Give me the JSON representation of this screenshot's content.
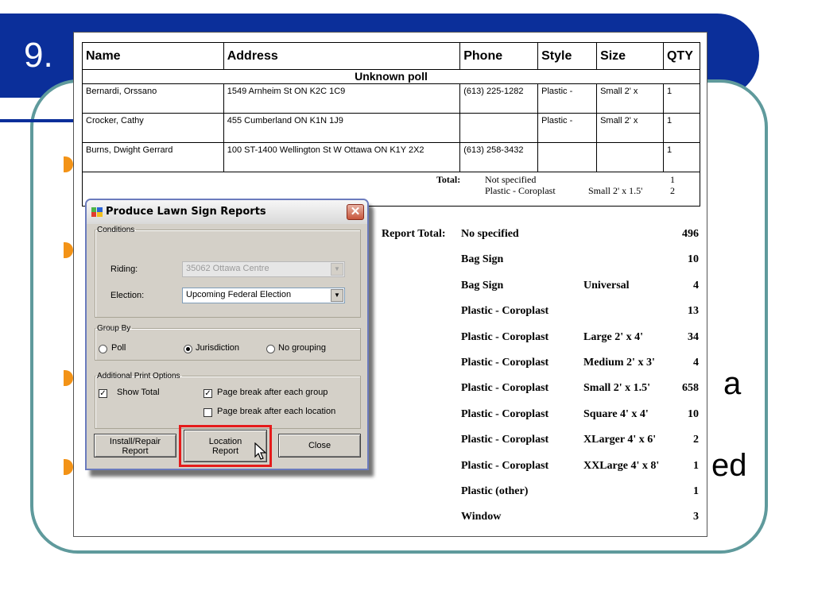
{
  "slide": {
    "number": "9.",
    "partial_text_a": "a",
    "partial_text_ed": "ed"
  },
  "report": {
    "headers": [
      "Name",
      "Address",
      "Phone",
      "Style",
      "Size",
      "QTY"
    ],
    "poll_heading": "Unknown poll",
    "rows": [
      {
        "name": "Bernardi, Orssano",
        "address": "1549 Arnheim St ON  K2C 1C9",
        "phone": "(613) 225-1282",
        "style": "Plastic -",
        "size": "Small 2' x",
        "qty": "1"
      },
      {
        "name": "Crocker, Cathy",
        "address": "455 Cumberland ON  K1N 1J9",
        "phone": "",
        "style": "Plastic -",
        "size": "Small 2' x",
        "qty": "1"
      },
      {
        "name": "Burns, Dwight Gerrard",
        "address": "100 ST-1400 Wellington St W Ottawa ON  K1Y 2X2",
        "phone": "(613) 258-3432",
        "style": "",
        "size": "",
        "qty": "1"
      }
    ],
    "total": {
      "label": "Total:",
      "line1_style": "Not specified",
      "line2_style": "Plastic - Coroplast",
      "line2_size": "Small 2' x 1.5'",
      "line1_qty": "1",
      "line2_qty": "2"
    },
    "report_total_label": "Report Total:",
    "report_total_rows": [
      {
        "style": "No specified",
        "size": "",
        "qty": "496"
      },
      {
        "style": "Bag Sign",
        "size": "",
        "qty": "10"
      },
      {
        "style": "Bag Sign",
        "size": "Universal",
        "qty": "4"
      },
      {
        "style": "Plastic - Coroplast",
        "size": "",
        "qty": "13"
      },
      {
        "style": "Plastic - Coroplast",
        "size": "Large 2' x 4'",
        "qty": "34"
      },
      {
        "style": "Plastic - Coroplast",
        "size": "Medium 2' x 3'",
        "qty": "4"
      },
      {
        "style": "Plastic - Coroplast",
        "size": "Small 2' x 1.5'",
        "qty": "658"
      },
      {
        "style": "Plastic - Coroplast",
        "size": "Square 4' x 4'",
        "qty": "10"
      },
      {
        "style": "Plastic - Coroplast",
        "size": "XLarger 4' x 6'",
        "qty": "2"
      },
      {
        "style": "Plastic - Coroplast",
        "size": "XXLarge 4' x 8'",
        "qty": "1"
      },
      {
        "style": "Plastic (other)",
        "size": "",
        "qty": "1"
      },
      {
        "style": "Window",
        "size": "",
        "qty": "3"
      }
    ]
  },
  "dialog": {
    "title": "Produce Lawn Sign Reports",
    "close_glyph": "✕",
    "conditions_legend": "Conditions",
    "riding_label": "Riding:",
    "riding_value": "35062 Ottawa Centre",
    "election_label": "Election:",
    "election_value": "Upcoming Federal Election",
    "group_by_legend": "Group By",
    "group_options": [
      "Poll",
      "Jurisdiction",
      "No grouping"
    ],
    "selected_group": "Jurisdiction",
    "print_options_legend": "Additional Print Options",
    "show_total_label": "Show Total",
    "show_total_checked": true,
    "page_break_group_label": "Page break after each group",
    "page_break_group_checked": true,
    "page_break_location_label": "Page break after each location",
    "page_break_location_checked": false,
    "install_button_line1": "Install/Repair",
    "install_button_line2": "Report",
    "location_button_line1": "Location",
    "location_button_line2": "Report",
    "close_button": "Close"
  },
  "colors": {
    "banner": "#0b2f9a",
    "frame": "#5f9a9c",
    "bullet": "#f39317",
    "highlight": "#e51b1b"
  }
}
